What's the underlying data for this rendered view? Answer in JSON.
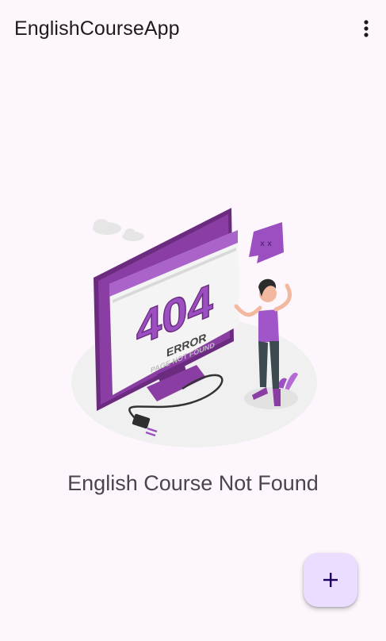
{
  "app_bar": {
    "title": "EnglishCourseApp",
    "menu_icon": "more-vert-icon"
  },
  "illustration": {
    "code_text": "404",
    "error_text": "ERROR",
    "subtext": "PAGE NOT FOUND",
    "accent_color": "#9c4fc0"
  },
  "empty_state": {
    "message": "English Course Not Found"
  },
  "fab": {
    "icon": "plus-icon",
    "background": "#eaddff"
  }
}
